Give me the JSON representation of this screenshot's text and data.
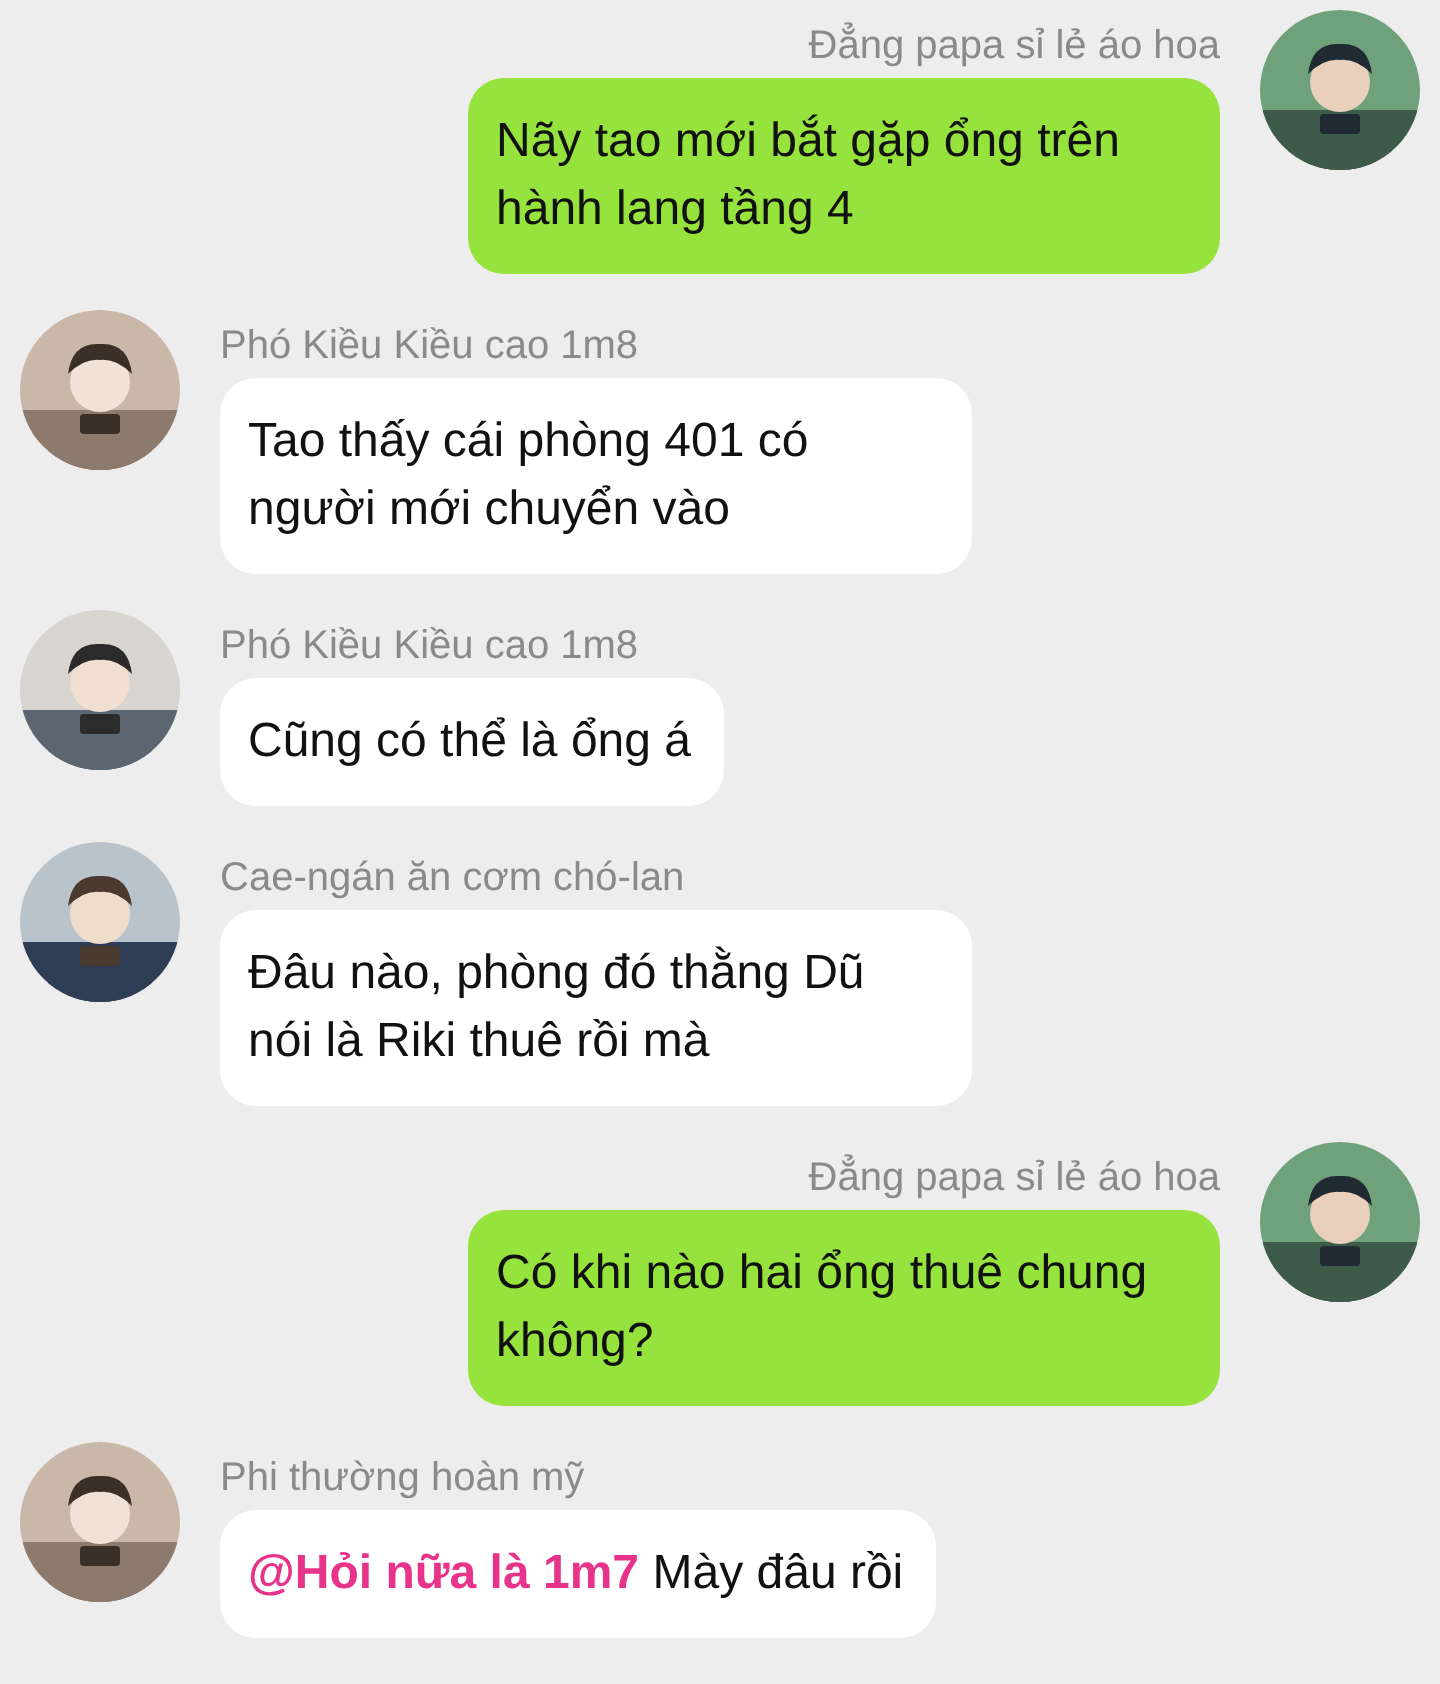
{
  "messages": [
    {
      "kind": "outgoing",
      "sender": "Đẳng papa sỉ lẻ áo hoa",
      "text": "Nãy tao mới bắt gặp ổng trên hành lang tầng 4"
    },
    {
      "kind": "incoming",
      "sender": "Phó Kiều Kiều cao 1m8",
      "text": "Tao thấy cái phòng 401 có người mới chuyển vào"
    },
    {
      "kind": "incoming",
      "sender": "Phó Kiều Kiều cao 1m8",
      "text": "Cũng có thể là ổng á"
    },
    {
      "kind": "incoming",
      "sender": "Cae-ngán ăn cơm chó-lan",
      "text": "Đâu nào, phòng đó thằng Dũ nói là Riki thuê rồi mà"
    },
    {
      "kind": "outgoing",
      "sender": "Đẳng papa sỉ lẻ áo hoa",
      "text": "Có khi nào hai ổng thuê chung không?"
    },
    {
      "kind": "incoming",
      "sender": "Phi thường hoàn mỹ",
      "mention": "@Hỏi nữa là 1m7",
      "text": "Mày đâu rồi"
    }
  ]
}
